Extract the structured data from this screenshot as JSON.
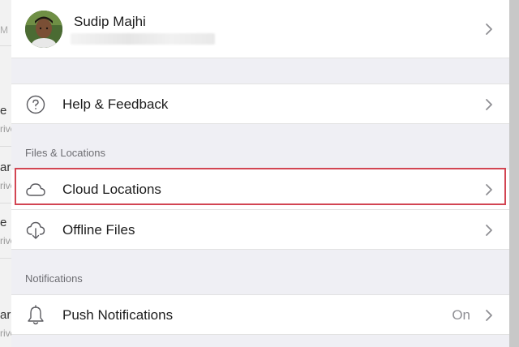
{
  "profile": {
    "name": "Sudip Majhi",
    "email": ""
  },
  "help": {
    "label": "Help & Feedback",
    "icon": "question-circle-icon"
  },
  "files_section": {
    "header": "Files & Locations",
    "items": [
      {
        "label": "Cloud Locations",
        "icon": "cloud-icon"
      },
      {
        "label": "Offline Files",
        "icon": "cloud-download-icon"
      }
    ]
  },
  "notifications_section": {
    "header": "Notifications",
    "items": [
      {
        "label": "Push Notifications",
        "value": "On",
        "icon": "bell-icon"
      }
    ]
  },
  "background_list": {
    "fragments": [
      "M",
      "e",
      "rive",
      "ar",
      "rive",
      "e",
      "rive",
      "ar",
      "rive"
    ]
  },
  "colors": {
    "highlight": "#d24552",
    "panel_background": "#efeff4",
    "row_background": "#ffffff"
  }
}
